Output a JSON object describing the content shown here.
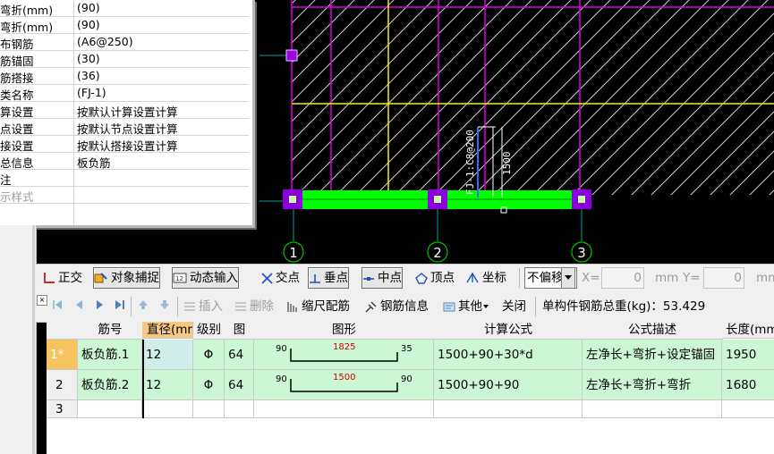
{
  "properties": [
    {
      "key": "弯折(mm)",
      "value": "(90)"
    },
    {
      "key": "弯折(mm)",
      "value": "(90)"
    },
    {
      "key": "布钢筋",
      "value": "(A6@250)"
    },
    {
      "key": "筋锚固",
      "value": "(30)"
    },
    {
      "key": "筋搭接",
      "value": "(36)"
    },
    {
      "key": "类名称",
      "value": "(FJ-1)"
    },
    {
      "key": "算设置",
      "value": "按默认计算设置计算"
    },
    {
      "key": "点设置",
      "value": "按默认节点设置计算"
    },
    {
      "key": "接设置",
      "value": "按默认搭接设置计算"
    },
    {
      "key": "总信息",
      "value": "板负筋"
    },
    {
      "key": "注",
      "value": ""
    },
    {
      "key": "示样式",
      "value": ""
    }
  ],
  "cad": {
    "axis_labels": [
      "1",
      "2",
      "3"
    ],
    "rebar_label": "FJ-1:C8@200",
    "dim_label": "1500"
  },
  "snap_toolbar": {
    "ortho": "正交",
    "object_snap": "对象捕捉",
    "dynamic_input": "动态输入",
    "intersection": "交点",
    "perpendicular": "垂点",
    "midpoint": "中点",
    "vertex": "顶点",
    "coordinate": "坐标",
    "offset_select": "不偏移",
    "x_label": "X=",
    "x_value": "0",
    "x_unit": "mm",
    "y_label": "Y=",
    "y_value": "0",
    "y_unit": "mm"
  },
  "rebar_toolbar": {
    "insert": "插入",
    "delete": "删除",
    "scale_rebar": "缩尺配筋",
    "rebar_info": "钢筋信息",
    "other": "其他",
    "close": "关闭",
    "total_weight": "单构件钢筋总重(kg)：53.429"
  },
  "table": {
    "headers": [
      "筋号",
      "直径(mm)",
      "级别",
      "图号",
      "图形",
      "计算公式",
      "公式描述",
      "长度(mm)"
    ],
    "rows": [
      {
        "num": "1*",
        "name": "板负筋.1",
        "dia": "12",
        "grade": "Φ",
        "fig": "64",
        "left": "90",
        "mid": "1825",
        "right": "35",
        "formula": "1500+90+30*d",
        "desc": "左净长+弯折+设定锚固",
        "len": "1950"
      },
      {
        "num": "2",
        "name": "板负筋.2",
        "dia": "12",
        "grade": "Φ",
        "fig": "64",
        "left": "90",
        "mid": "1500",
        "right": "90",
        "formula": "1500+90+90",
        "desc": "左净长+弯折+弯折",
        "len": "1680"
      },
      {
        "num": "3",
        "name": "",
        "dia": "",
        "grade": "",
        "fig": "",
        "left": "",
        "mid": "",
        "right": "",
        "formula": "",
        "desc": "",
        "len": ""
      }
    ]
  }
}
